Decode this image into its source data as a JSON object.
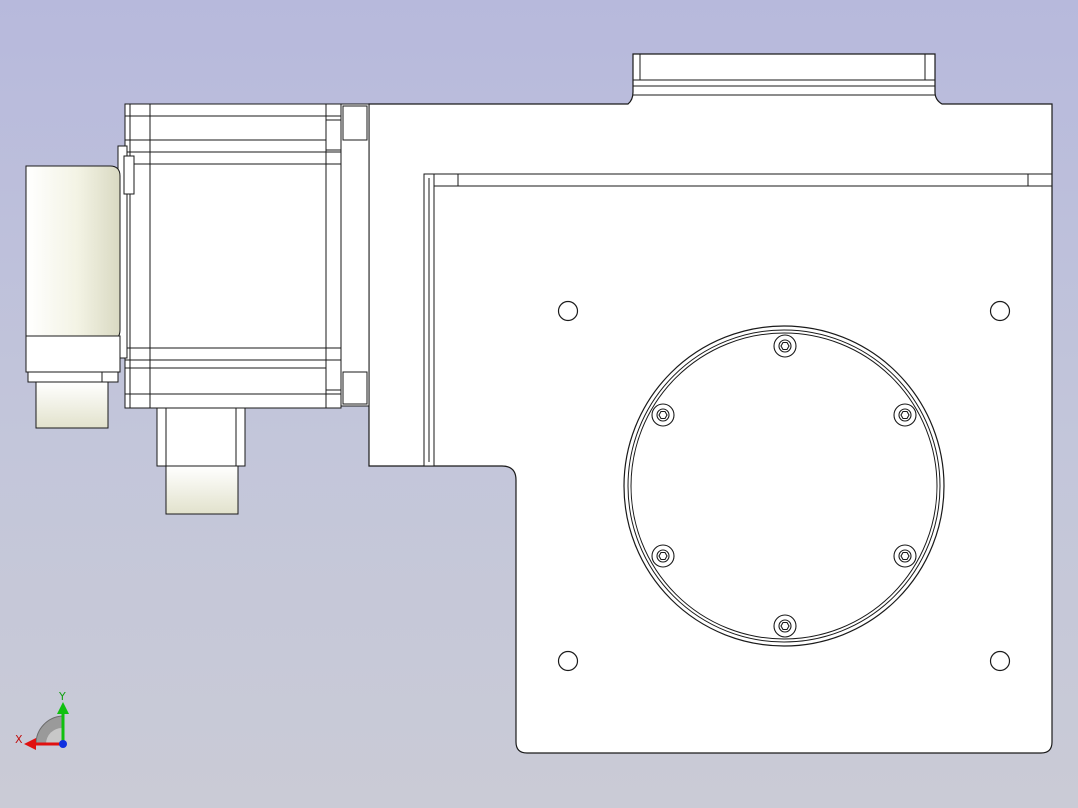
{
  "viewport": {
    "background_top": "#b7b9dc",
    "background_bottom": "#cacbd6",
    "part_fill": "#ffffff",
    "edge_color": "#1a1a1a",
    "shade_color": "#e9e9d4"
  },
  "triad": {
    "x_label": "X",
    "y_label": "Y",
    "x_color": "#e01010",
    "y_color": "#10c010",
    "z_color": "#1030e0"
  }
}
